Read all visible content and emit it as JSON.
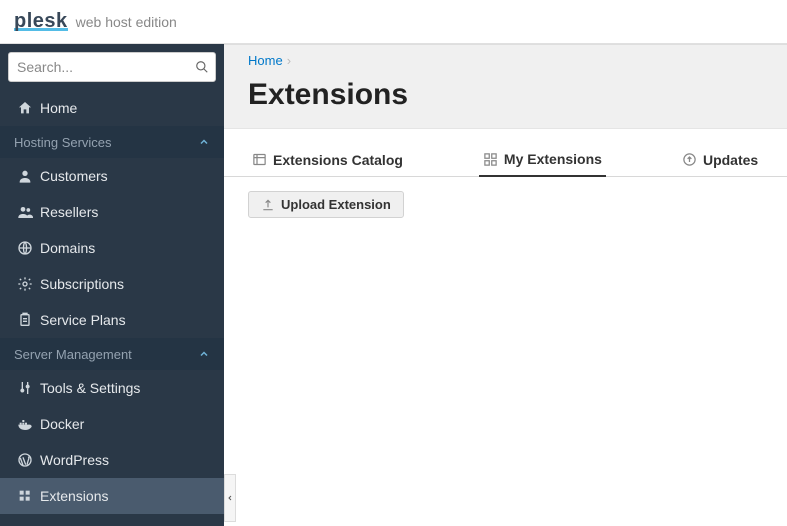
{
  "brand": {
    "name": "plesk",
    "edition": "web host edition"
  },
  "search": {
    "placeholder": "Search..."
  },
  "nav": {
    "home": "Home",
    "section_hosting": "Hosting Services",
    "customers": "Customers",
    "resellers": "Resellers",
    "domains": "Domains",
    "subscriptions": "Subscriptions",
    "service_plans": "Service Plans",
    "section_server": "Server Management",
    "tools": "Tools & Settings",
    "docker": "Docker",
    "wordpress": "WordPress",
    "extensions": "Extensions"
  },
  "breadcrumb": {
    "home": "Home"
  },
  "page": {
    "title": "Extensions"
  },
  "tabs": {
    "catalog": "Extensions Catalog",
    "my": "My Extensions",
    "updates": "Updates"
  },
  "actions": {
    "upload": "Upload Extension"
  }
}
